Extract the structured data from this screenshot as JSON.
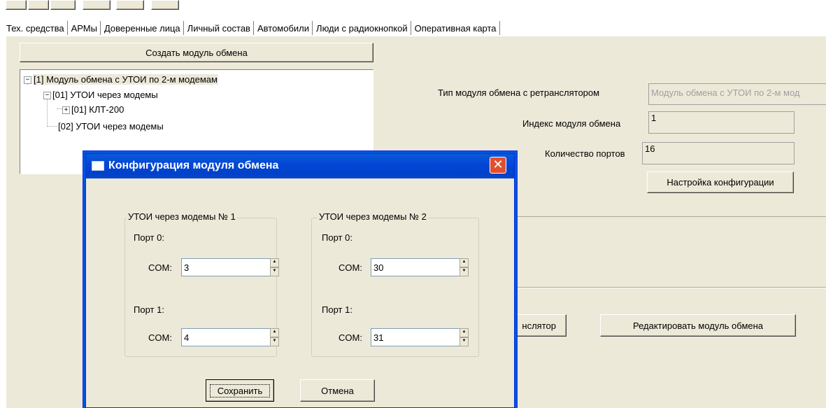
{
  "tabs": [
    {
      "label": "Тех. средства",
      "active": true
    },
    {
      "label": "АРМы",
      "active": false
    },
    {
      "label": "Доверенные лица",
      "active": false
    },
    {
      "label": "Личный состав",
      "active": false
    },
    {
      "label": "Автомобили",
      "active": false
    },
    {
      "label": "Люди с радиокнопкой",
      "active": false
    },
    {
      "label": "Оперативная карта",
      "active": false
    }
  ],
  "create_button": "Создать модуль обмена",
  "tree": {
    "root": "[1] Модуль обмена с УТОИ по 2-м модемам",
    "child1": "[01] УТОИ через модемы",
    "grandchild1": "[01] КЛТ-200",
    "child2": "[02] УТОИ через модемы"
  },
  "props": {
    "type_label": "Тип модуля обмена с ретранслятором",
    "type_value": "Модуль обмена с УТОИ по 2-м мод",
    "index_label": "Индекс модуля обмена",
    "index_value": "1",
    "ports_label": "Количество портов",
    "ports_value": "16",
    "config_button": "Настройка конфигурации"
  },
  "bottom": {
    "retr_button_partial": "нслятор",
    "edit_button": "Редактировать модуль обмена"
  },
  "dialog": {
    "title": "Конфигурация модуля обмена",
    "group1": {
      "title": "УТОИ через модемы № 1",
      "port0_label": "Порт 0:",
      "port1_label": "Порт 1:",
      "com_label": "COM:",
      "port0_value": "3",
      "port1_value": "4"
    },
    "group2": {
      "title": "УТОИ через модемы № 2",
      "port0_label": "Порт 0:",
      "port1_label": "Порт 1:",
      "com_label": "COM:",
      "port0_value": "30",
      "port1_value": "31"
    },
    "save_button": "Сохранить",
    "cancel_button": "Отмена"
  },
  "colors": {
    "title_bar": "#0054e3",
    "close_button": "#e05030"
  }
}
